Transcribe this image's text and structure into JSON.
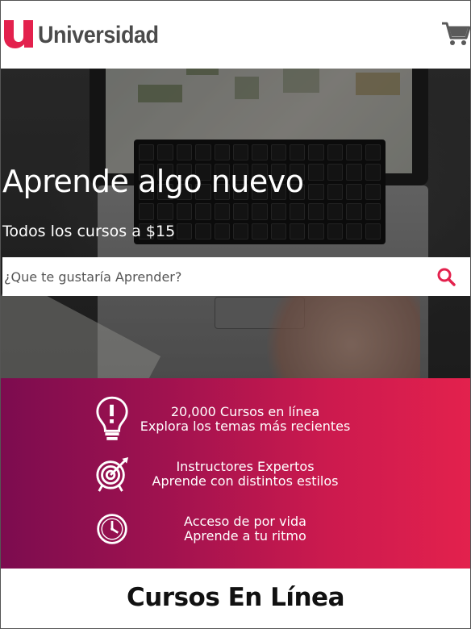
{
  "brand": {
    "logo_text": "Universidad",
    "accent_color": "#e3214d",
    "gradient_start": "#7c0c4f"
  },
  "header": {
    "cart_icon": "shopping-cart-icon"
  },
  "hero": {
    "title": "Aprende algo nuevo",
    "subtitle": "Todos los cursos a $15",
    "search": {
      "placeholder": "¿Que te gustaría Aprender?",
      "value": "",
      "button_icon": "search-icon"
    }
  },
  "features": [
    {
      "icon": "lightbulb-icon",
      "line1": "20,000 Cursos en línea",
      "line2": "Explora los temas más recientes"
    },
    {
      "icon": "target-icon",
      "line1": "Instructores Expertos",
      "line2": "Aprende con distintos estilos"
    },
    {
      "icon": "clock-icon",
      "line1": "Acceso de por vida",
      "line2": "Aprende a tu ritmo"
    }
  ],
  "sections": {
    "courses_title": "Cursos En Línea"
  }
}
